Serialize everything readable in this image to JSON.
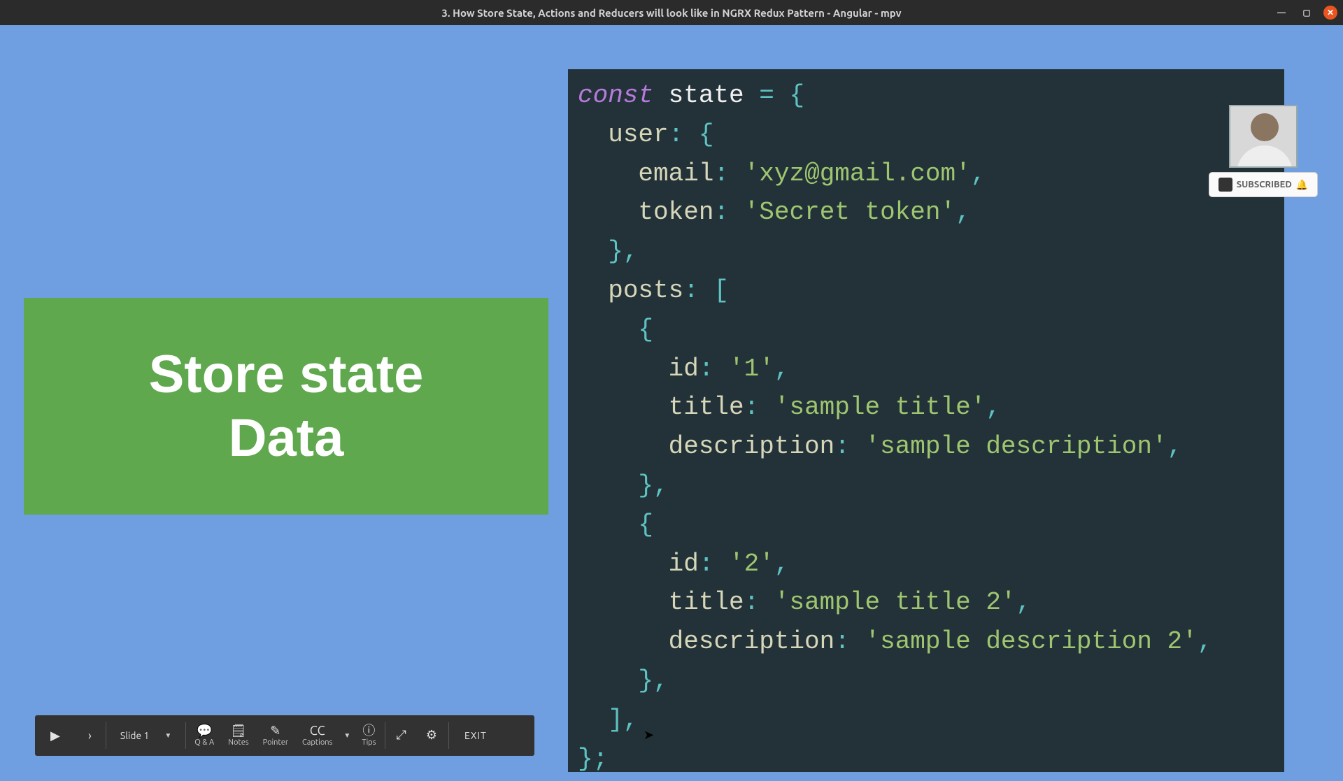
{
  "window": {
    "title": "3. How Store State, Actions and Reducers will look like in NGRX Redux Pattern - Angular - mpv"
  },
  "slide": {
    "heading_line1": "Store state",
    "heading_line2": "Data"
  },
  "code": {
    "const": "const",
    "varname": "state",
    "user_key": "user",
    "email_key": "email",
    "email_val": "'xyz@gmail.com'",
    "token_key": "token",
    "token_val": "'Secret token'",
    "posts_key": "posts",
    "id_key": "id",
    "id1_val": "'1'",
    "title_key": "title",
    "title1_val": "'sample title'",
    "desc_key": "description",
    "desc1_val": "'sample description'",
    "id2_val": "'2'",
    "title2_val": "'sample title 2'",
    "desc2_val": "'sample description 2'"
  },
  "subscribe": {
    "label": "SUBSCRIBED"
  },
  "toolbar": {
    "slide_label": "Slide 1",
    "qa": "Q & A",
    "notes": "Notes",
    "pointer": "Pointer",
    "captions": "Captions",
    "tips": "Tips",
    "exit": "EXIT"
  }
}
